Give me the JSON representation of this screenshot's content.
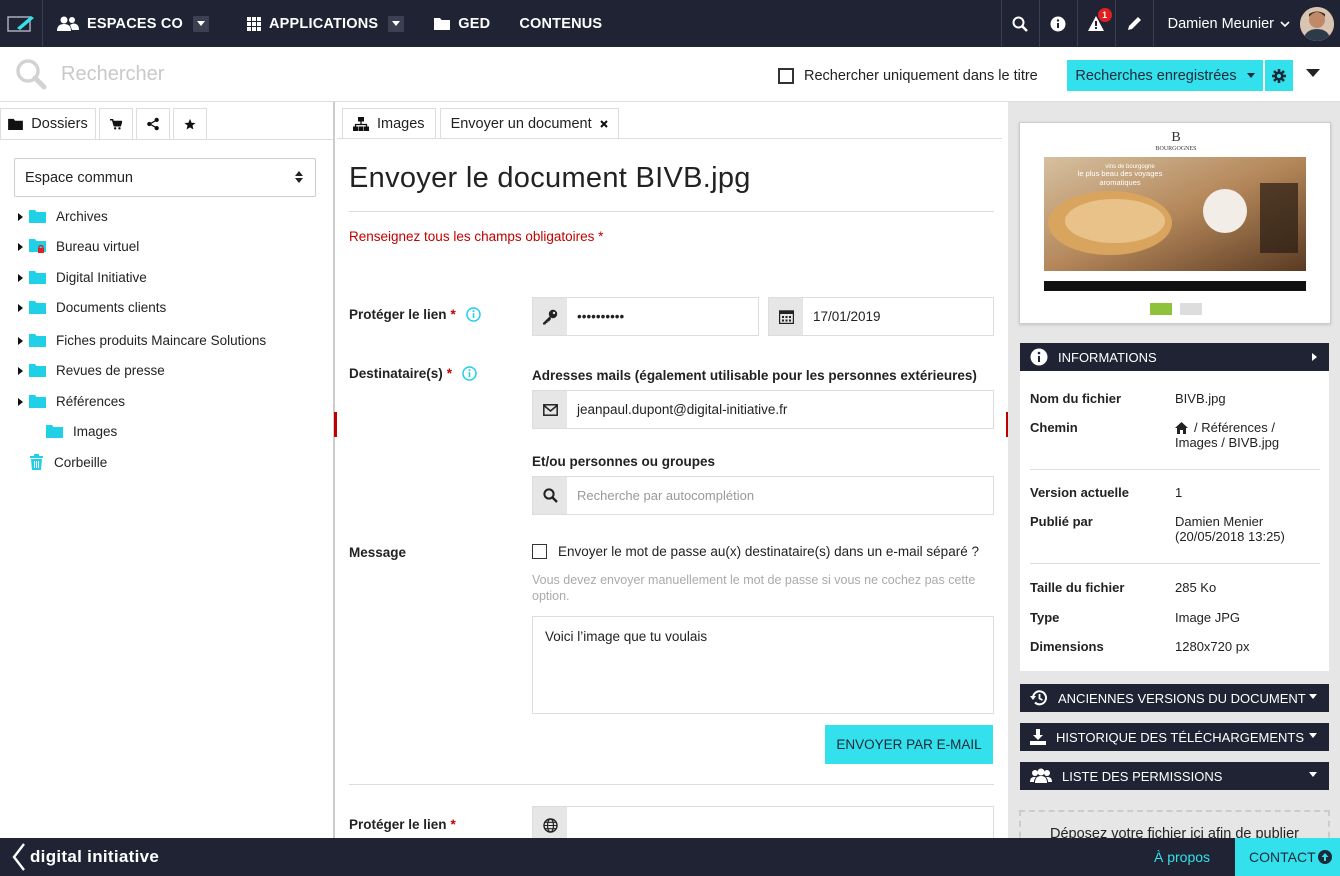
{
  "nav": {
    "espaces": "ESPACES CO",
    "applications": "APPLICATIONS",
    "ged": "GED",
    "contenus": "CONTENUS",
    "notif_count": "1",
    "user_name": "Damien Meunier"
  },
  "search": {
    "placeholder": "Rechercher",
    "only_title_label": "Rechercher uniquement dans le titre",
    "saved_label": "Recherches enregistrées"
  },
  "left": {
    "tab_dossiers": "Dossiers",
    "space_selected": "Espace commun",
    "folders": [
      "Archives",
      "Bureau virtuel",
      "Digital Initiative",
      "Documents clients",
      "Fiches produits Maincare Solutions",
      "Revues de presse",
      "Références",
      "Images",
      "Corbeille"
    ]
  },
  "center": {
    "tab_images": "Images",
    "tab_send": "Envoyer un document",
    "title": "Envoyer le document BIVB.jpg",
    "required_note": "Renseignez tous les champs obligatoires *",
    "protect_label": "Protéger le lien",
    "password_value": "••••••••••",
    "date_value": "17/01/2019",
    "recipients_label": "Destinataire(s)",
    "emails_label": "Adresses mails (également utilisable pour les personnes extérieures)",
    "email_value": "jeanpaul.dupont@digital-initiative.fr",
    "persons_label": "Et/ou personnes ou groupes",
    "persons_placeholder": "Recherche par autocomplétion",
    "message_label": "Message",
    "separate_pw_label": "Envoyer le mot de passe au(x) destinataire(s) dans un e-mail séparé ?",
    "help_text": "Vous devez envoyer manuellement le mot de passe si vous ne cochez pas cette option.",
    "message_value": "Voici l’image que tu voulais",
    "send_button": "ENVOYER PAR E-MAIL",
    "protect_label_2": "Protéger le lien",
    "required_star": "*"
  },
  "right": {
    "preview": {
      "brand": "BOURGOGNES",
      "line1": "vins de bourgogne",
      "line2": "le plus beau des voyages",
      "line3": "aromatiques"
    },
    "informations": "INFORMATIONS",
    "nom_k": "Nom du fichier",
    "nom_v": "BIVB.jpg",
    "chemin_k": "Chemin",
    "chemin_v1": "/  Références  /",
    "chemin_v2": "Images  /  BIVB.jpg",
    "version_k": "Version actuelle",
    "version_v": "1",
    "publie_k": "Publié par",
    "publie_v1": "Damien Menier",
    "publie_v2": "(20/05/2018 13:25)",
    "taille_k": "Taille du fichier",
    "taille_v": "285 Ko",
    "type_k": "Type",
    "type_v": "Image JPG",
    "dim_k": "Dimensions",
    "dim_v": "1280x720 px",
    "anciennes": "ANCIENNES VERSIONS DU DOCUMENT",
    "historique": "HISTORIQUE DES TÉLÉCHARGEMENTS",
    "permissions": "LISTE DES PERMISSIONS",
    "dropzone": "Déposez votre fichier ici afin de publier"
  },
  "footer": {
    "logo_text": "digital initiative",
    "apropos": "À propos",
    "contact": "CONTACT"
  },
  "colors": {
    "nav_bg": "#1f2333",
    "accent": "#32e1ec",
    "required": "#c00000",
    "folder": "#1fd0e6"
  }
}
